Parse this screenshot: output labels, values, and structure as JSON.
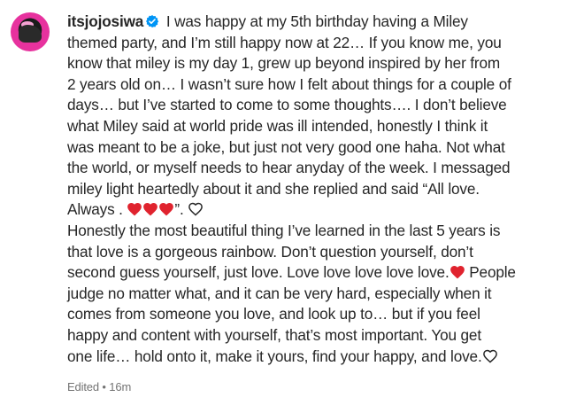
{
  "post": {
    "username": "itsjojosiwa",
    "verified_icon": "verified-badge-icon",
    "lines": [
      " I was happy at my 5th birthday having a Miley",
      "themed party, and I’m still happy now at 22… If you know me, you",
      "know that miley is my day 1, grew up beyond inspired by her from",
      "2 years old on… I wasn’t sure how I felt about things for a couple of",
      "days… but I’ve started to come to some thoughts…. I don’t believe",
      "what Miley said at world pride was ill intended, honestly I think it",
      "was meant to be a joke, but just not very good one haha. Not what",
      "the world, or myself needs to hear anyday of the week. I messaged",
      "miley light heartedly about it and she replied and said “All love."
    ],
    "always_text": "Always . ",
    "quote_close": "”. ",
    "lines2": [
      "Honestly the most beautiful thing I’ve learned in the last 5 years is",
      "that love is a gorgeous rainbow. Don’t question yourself, don’t"
    ],
    "line_love": "second guess yourself, just love. Love love love love love.",
    "people_text": " People",
    "lines3": [
      "judge no matter what, and it can be very hard, especially when it",
      "comes from someone you love, and look up to… but if you feel",
      "happy and content with yourself, that’s most important. You get"
    ],
    "last_line": "one life… hold onto it, make it yours, find your happy, and love.",
    "meta": "Edited • 16m",
    "colors": {
      "heart_red": "#e0232e",
      "verified_blue": "#0095f6",
      "text": "#262626",
      "meta": "#737373"
    }
  }
}
